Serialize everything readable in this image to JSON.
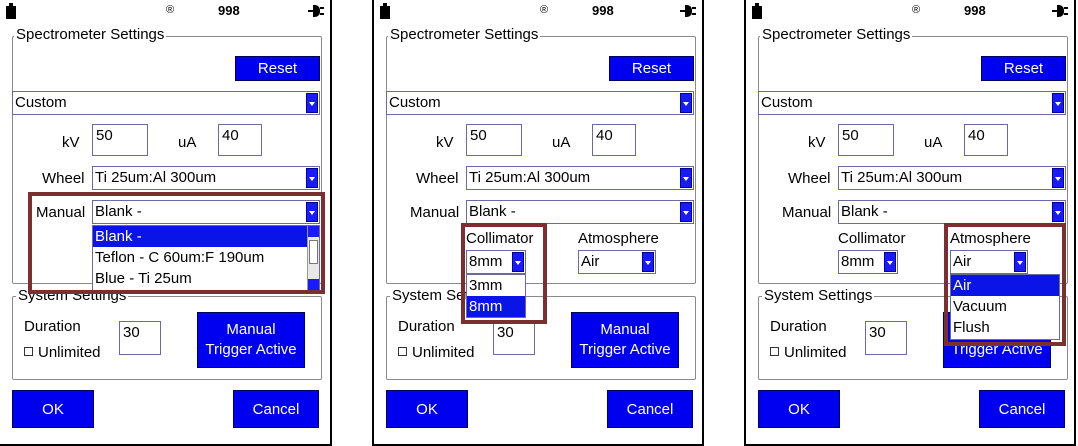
{
  "status": {
    "record_glyph": "®",
    "counter": "998"
  },
  "labels": {
    "spectrometer_settings": "Spectrometer Settings",
    "system_settings": "System Settings",
    "reset": "Reset",
    "kv": "kV",
    "ua": "uA",
    "wheel": "Wheel",
    "manual": "Manual",
    "collimator": "Collimator",
    "atmosphere": "Atmosphere",
    "duration": "Duration",
    "unlimited": "Unlimited",
    "trigger_line1": "Manual",
    "trigger_line2": "Trigger Active",
    "ok": "OK",
    "cancel": "Cancel"
  },
  "values": {
    "preset": "Custom",
    "kv": "50",
    "ua": "40",
    "wheel": "Ti 25um:Al 300um",
    "manual": "Blank -",
    "collimator": "8mm",
    "atmosphere": "Air",
    "duration": "30"
  },
  "dropdowns": {
    "manual_options": [
      "Blank -",
      "Teflon - C 60um:F 190um",
      "Blue - Ti 25um"
    ],
    "collimator_options": [
      "3mm",
      "8mm"
    ],
    "atmosphere_options": [
      "Air",
      "Vacuum",
      "Flush"
    ]
  },
  "colors": {
    "button_blue": "#0000f0",
    "selection_blue": "#0a14e6",
    "highlight_box": "#7b2f2f"
  }
}
